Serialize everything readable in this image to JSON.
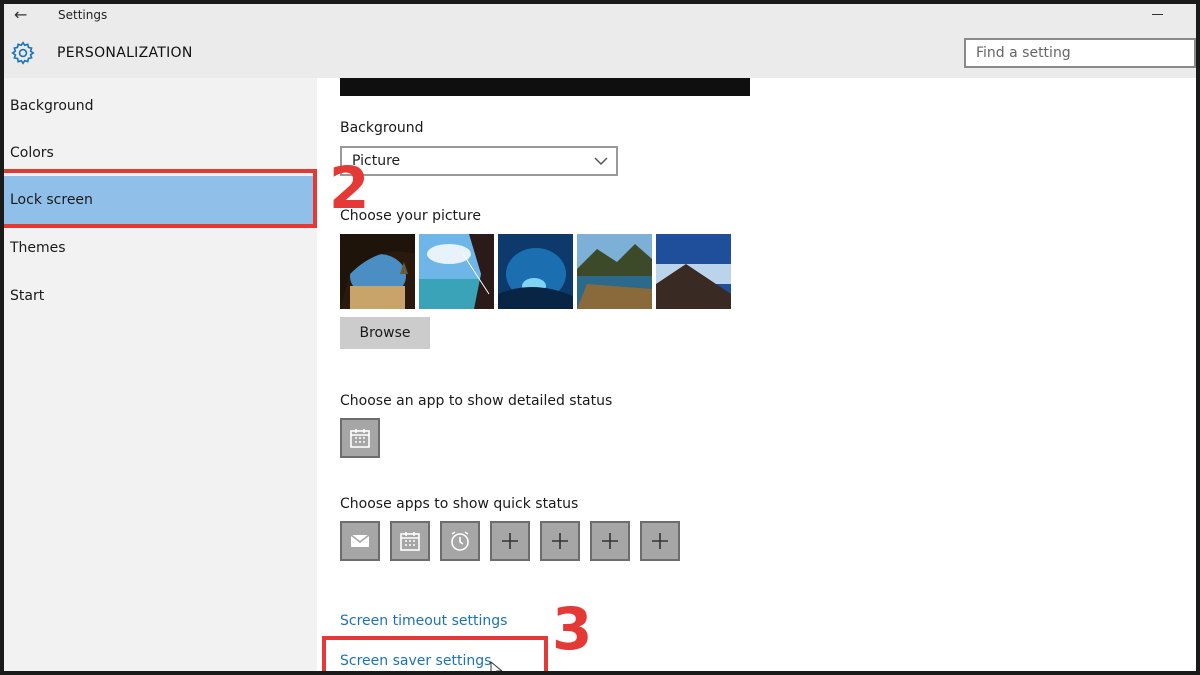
{
  "titlebar": {
    "back_label": "←",
    "title": "Settings"
  },
  "header": {
    "section_title": "PERSONALIZATION",
    "search_placeholder": "Find a setting",
    "gear_icon": "gear-icon"
  },
  "sidebar": {
    "items": [
      {
        "label": "Background"
      },
      {
        "label": "Colors"
      },
      {
        "label": "Lock screen",
        "selected": true
      },
      {
        "label": "Themes"
      },
      {
        "label": "Start"
      }
    ]
  },
  "annotations": {
    "step2": "2",
    "step3": "3",
    "highlight_color": "#e53935"
  },
  "main": {
    "background_label": "Background",
    "background_value": "Picture",
    "choose_picture_label": "Choose your picture",
    "browse_label": "Browse",
    "detailed_status_label": "Choose an app to show detailed status",
    "quick_status_label": "Choose apps to show quick status",
    "quick_status_icons": [
      "mail-icon",
      "calendar-icon",
      "alarm-icon",
      "plus-icon",
      "plus-icon",
      "plus-icon",
      "plus-icon"
    ],
    "screen_timeout_link": "Screen timeout settings",
    "screen_saver_link": "Screen saver settings"
  },
  "colors": {
    "selected_nav": "#90c0ea",
    "link": "#1a73b8",
    "tile": "#a6a6a6"
  }
}
